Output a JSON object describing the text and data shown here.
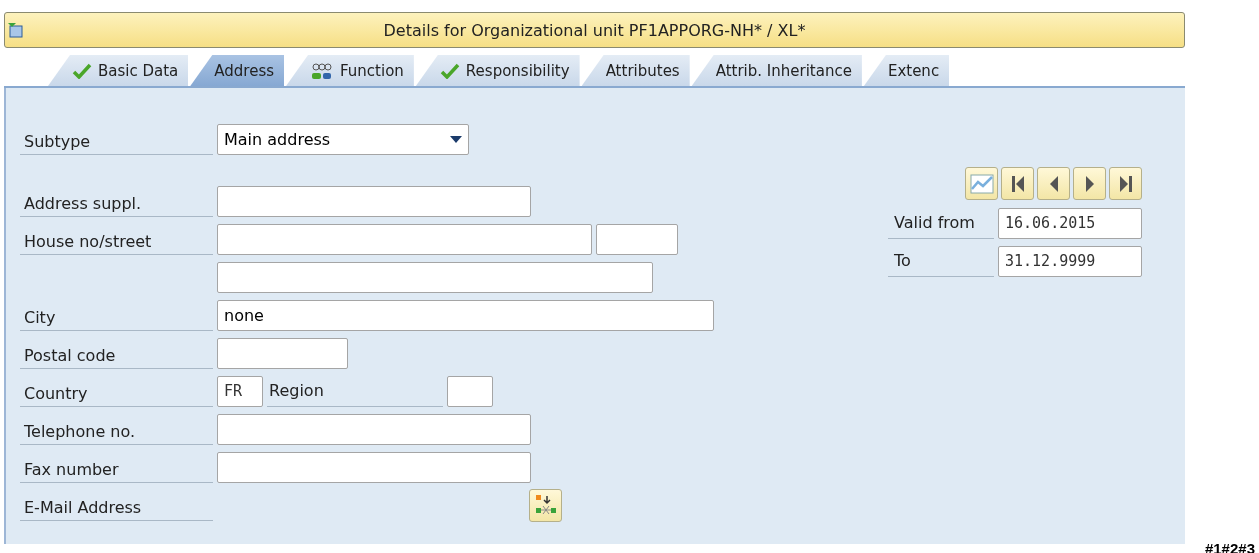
{
  "window": {
    "title": "Details for Organizational unit PF1APPORG-NH* / XL*"
  },
  "tabs": [
    {
      "label": "Basic Data",
      "selected": false,
      "kind": "check"
    },
    {
      "label": "Address",
      "selected": true,
      "kind": "plain"
    },
    {
      "label": "Function",
      "selected": false,
      "kind": "people"
    },
    {
      "label": "Responsibility",
      "selected": false,
      "kind": "check"
    },
    {
      "label": "Attributes",
      "selected": false,
      "kind": "plain"
    },
    {
      "label": "Attrib. Inheritance",
      "selected": false,
      "kind": "plain"
    },
    {
      "label": "Extenc",
      "selected": false,
      "kind": "plain"
    }
  ],
  "form": [
    {
      "kind": "dropdown",
      "label": "Subtype",
      "value": "Main address"
    },
    {
      "kind": "text",
      "label": "Address suppl."
    },
    {
      "kind": "street",
      "label": "House no/street"
    },
    {
      "kind": "text"
    },
    {
      "kind": "text",
      "label": "City",
      "value": "none"
    },
    {
      "kind": "text",
      "label": "Postal code"
    },
    {
      "kind": "country",
      "label": "Country",
      "value": "FR",
      "region_label": "Region"
    },
    {
      "kind": "text",
      "label": "Telephone no."
    },
    {
      "kind": "text",
      "label": "Fax number"
    },
    {
      "kind": "email",
      "label": "E-Mail Address"
    }
  ],
  "validity": [
    {
      "label": "Valid from",
      "value": "16.06.2015"
    },
    {
      "label": "To",
      "value": "31.12.9999"
    }
  ],
  "corner_mark": "#1#2#3"
}
